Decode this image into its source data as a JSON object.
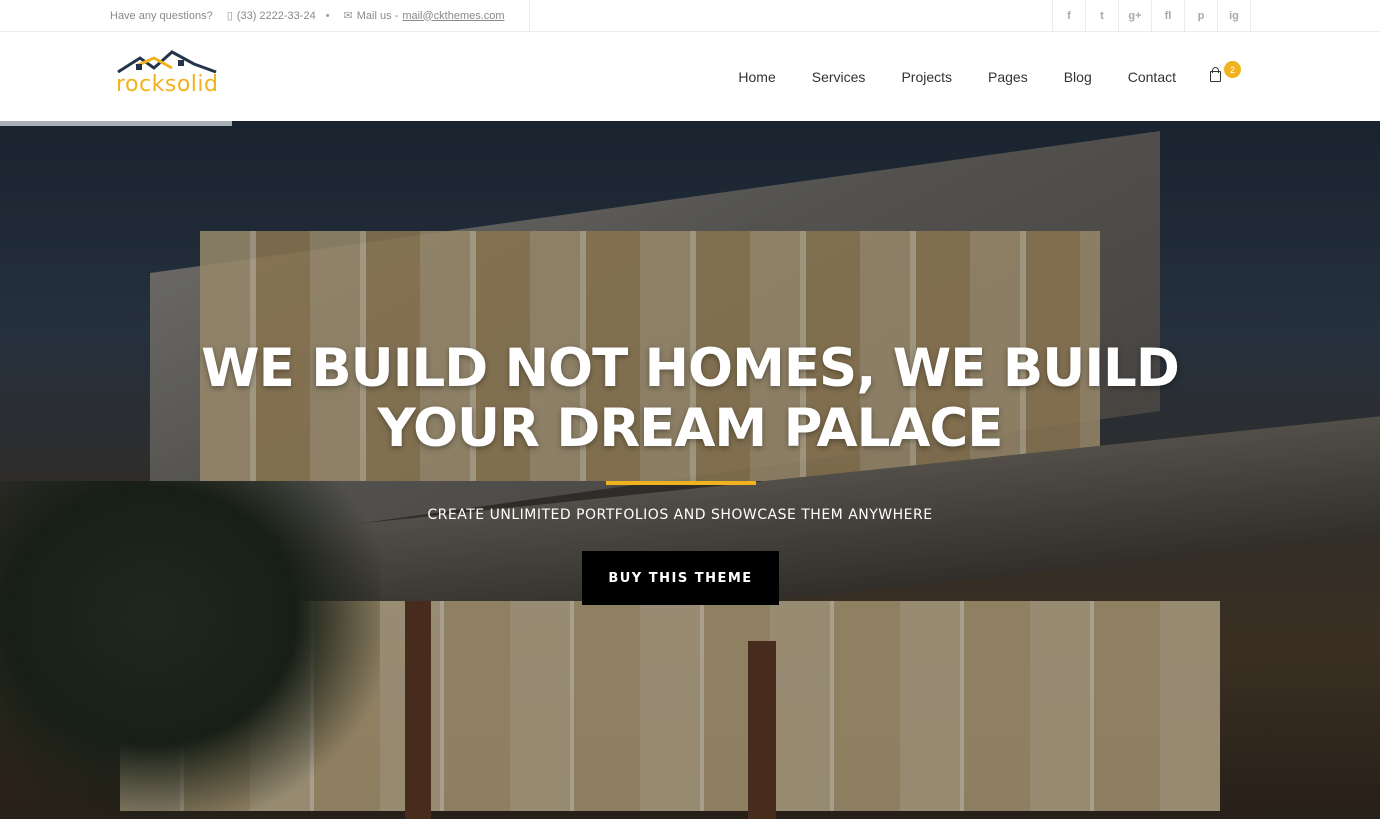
{
  "topbar": {
    "question": "Have any questions?",
    "phone": "(33) 2222-33-24",
    "separator": "•",
    "mail_prefix": "Mail us -",
    "mail": "mail@ckthemes.com",
    "social": [
      "f",
      "t",
      "g+",
      "fl",
      "p",
      "ig"
    ]
  },
  "brand": {
    "logo_text": "rocksolid",
    "accent": "#f0b21e",
    "roof_color": "#24344a"
  },
  "nav": {
    "items": [
      "Home",
      "Services",
      "Projects",
      "Pages",
      "Blog",
      "Contact"
    ],
    "cart_count": "2"
  },
  "hero": {
    "title_line1": "WE BUILD NOT HOMES, WE BUILD",
    "title_line2": "YOUR DREAM PALACE",
    "subtitle": "CREATE UNLIMITED PORTFOLIOS AND SHOWCASE THEM ANYWHERE",
    "cta": "BUY THIS THEME"
  }
}
